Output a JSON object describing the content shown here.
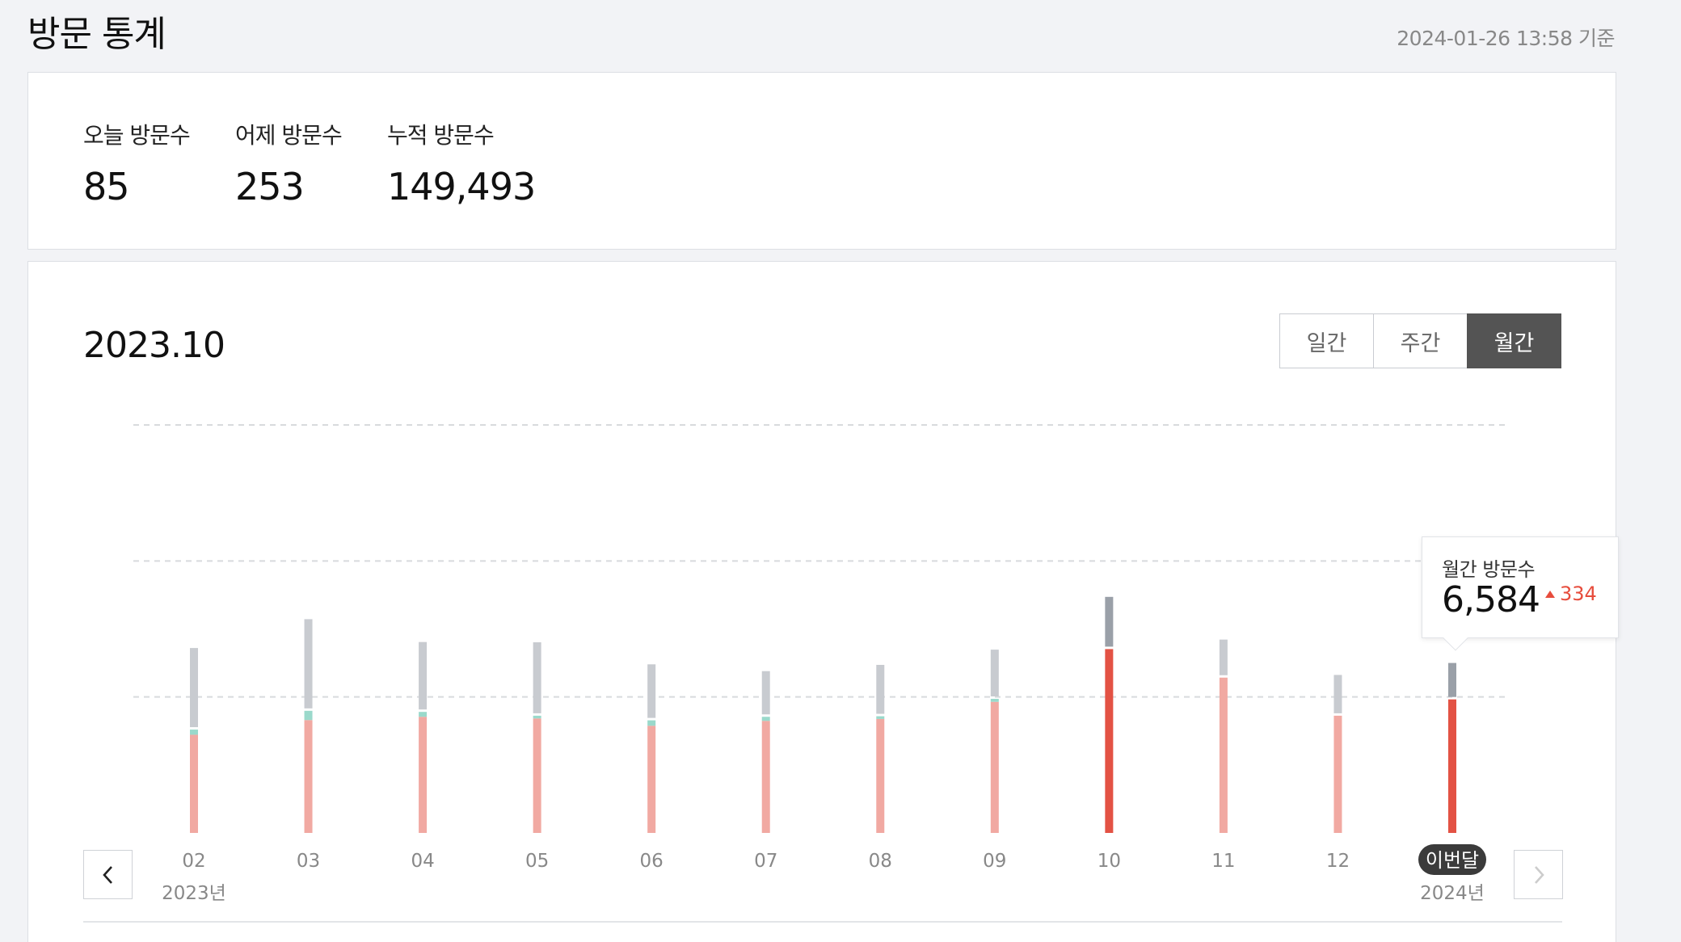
{
  "header": {
    "title": "방문 통계",
    "timestamp": "2024-01-26 13:58 기준"
  },
  "summary": [
    {
      "label": "오늘 방문수",
      "value": "85"
    },
    {
      "label": "어제 방문수",
      "value": "253"
    },
    {
      "label": "누적 방문수",
      "value": "149,493"
    }
  ],
  "chart_section": {
    "period_title": "2023.10",
    "toggles": [
      {
        "label": "일간",
        "active": false
      },
      {
        "label": "주간",
        "active": false
      },
      {
        "label": "월간",
        "active": true
      }
    ]
  },
  "tooltip": {
    "label": "월간 방문수",
    "value": "6,584",
    "change": "334"
  },
  "colors": {
    "bar_light": "#f1a9a2",
    "bar_highlight": "#e35244",
    "bar_gray": "#c8cbd0",
    "bar_gray_dark": "#9aa0a8",
    "bar_teal": "#9ad9cb",
    "grid": "#d8dadd"
  },
  "chart_data": {
    "type": "bar",
    "stacked": true,
    "grid": true,
    "categories": [
      "02",
      "03",
      "04",
      "05",
      "06",
      "07",
      "08",
      "09",
      "10",
      "11",
      "12",
      "이번달"
    ],
    "year_labels": [
      {
        "index": 0,
        "label": "2023년"
      },
      {
        "index": 11,
        "label": "2024년"
      }
    ],
    "current_label_index": 11,
    "highlight_indices": [
      8,
      11
    ],
    "series": [
      {
        "values": [
          3610,
          4150,
          4270,
          4210,
          3940,
          4120,
          4190,
          4820,
          6760,
          5710,
          4310,
          4910
        ]
      },
      {
        "values": [
          190,
          340,
          180,
          100,
          200,
          150,
          100,
          110,
          0,
          0,
          0,
          0
        ]
      },
      {
        "values": [
          2910,
          3280,
          2480,
          2610,
          1970,
          1590,
          1800,
          1720,
          1830,
          1310,
          1410,
          1250
        ]
      }
    ],
    "ylim": [
      0,
      15000
    ],
    "gridlines": [
      5000,
      10000,
      15000
    ]
  }
}
